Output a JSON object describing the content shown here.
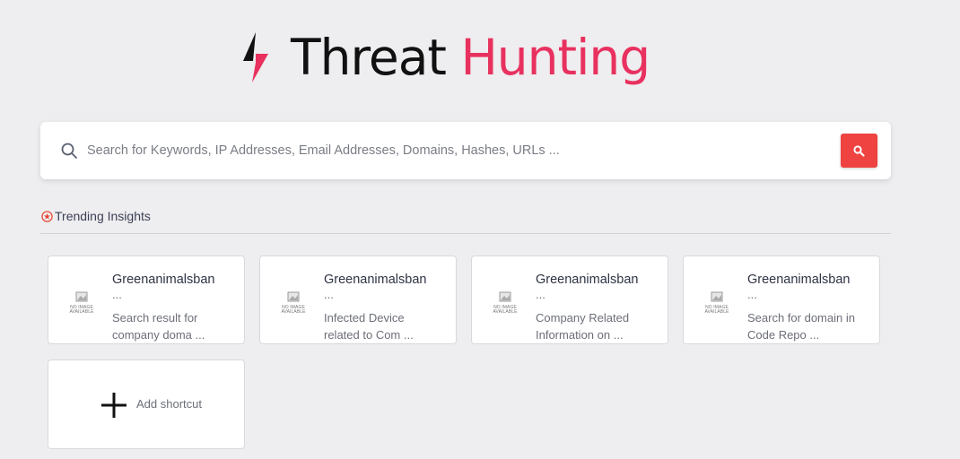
{
  "logo": {
    "icon": "lightning-bolt-icon",
    "word1": "Threat",
    "word2": "Hunting",
    "colors": {
      "word1": "#111111",
      "word2": "#e8315f"
    }
  },
  "search": {
    "placeholder": "Search for Keywords, IP Addresses, Email Addresses, Domains, Hashes, URLs ...",
    "value": "",
    "button_icon": "search-icon",
    "button_color": "#ee4340"
  },
  "trending": {
    "icon": "star-circle-icon",
    "label": "Trending Insights"
  },
  "no_image": {
    "line1": "NO IMAGE",
    "line2": "AVAILABLE"
  },
  "cards": [
    {
      "title": "Greenanimalsban",
      "ellipsis": "...",
      "desc": "Search result for company doma ..."
    },
    {
      "title": "Greenanimalsban",
      "ellipsis": "...",
      "desc": "Infected Device related to Com ..."
    },
    {
      "title": "Greenanimalsban",
      "ellipsis": "...",
      "desc": "Company Related Information on ..."
    },
    {
      "title": "Greenanimalsban",
      "ellipsis": "...",
      "desc": "Search for domain in Code Repo ..."
    }
  ],
  "shortcut": {
    "icon": "plus-icon",
    "label": "Add shortcut"
  }
}
